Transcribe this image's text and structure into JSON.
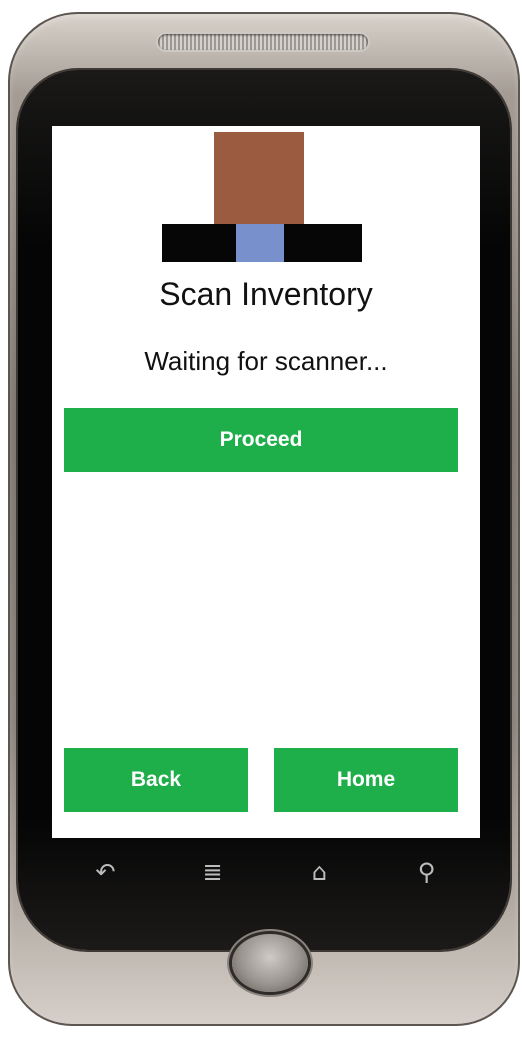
{
  "screen": {
    "title": "Scan Inventory",
    "status": "Waiting for scanner...",
    "proceed_label": "Proceed",
    "back_label": "Back",
    "home_label": "Home"
  },
  "logo": {
    "colors": {
      "top_block": "#9b5b40",
      "base_bar": "#060606",
      "center_block": "#7890cb"
    }
  },
  "colors": {
    "button": "#1eaf4b",
    "button_text": "#ffffff",
    "screen_bg": "#ffffff"
  },
  "navbar": {
    "keys": [
      {
        "icon": "back-arrow-icon",
        "glyph": "↶"
      },
      {
        "icon": "menu-icon",
        "glyph": "≣"
      },
      {
        "icon": "home-icon",
        "glyph": "⌂"
      },
      {
        "icon": "search-icon",
        "glyph": "⚲"
      }
    ]
  }
}
